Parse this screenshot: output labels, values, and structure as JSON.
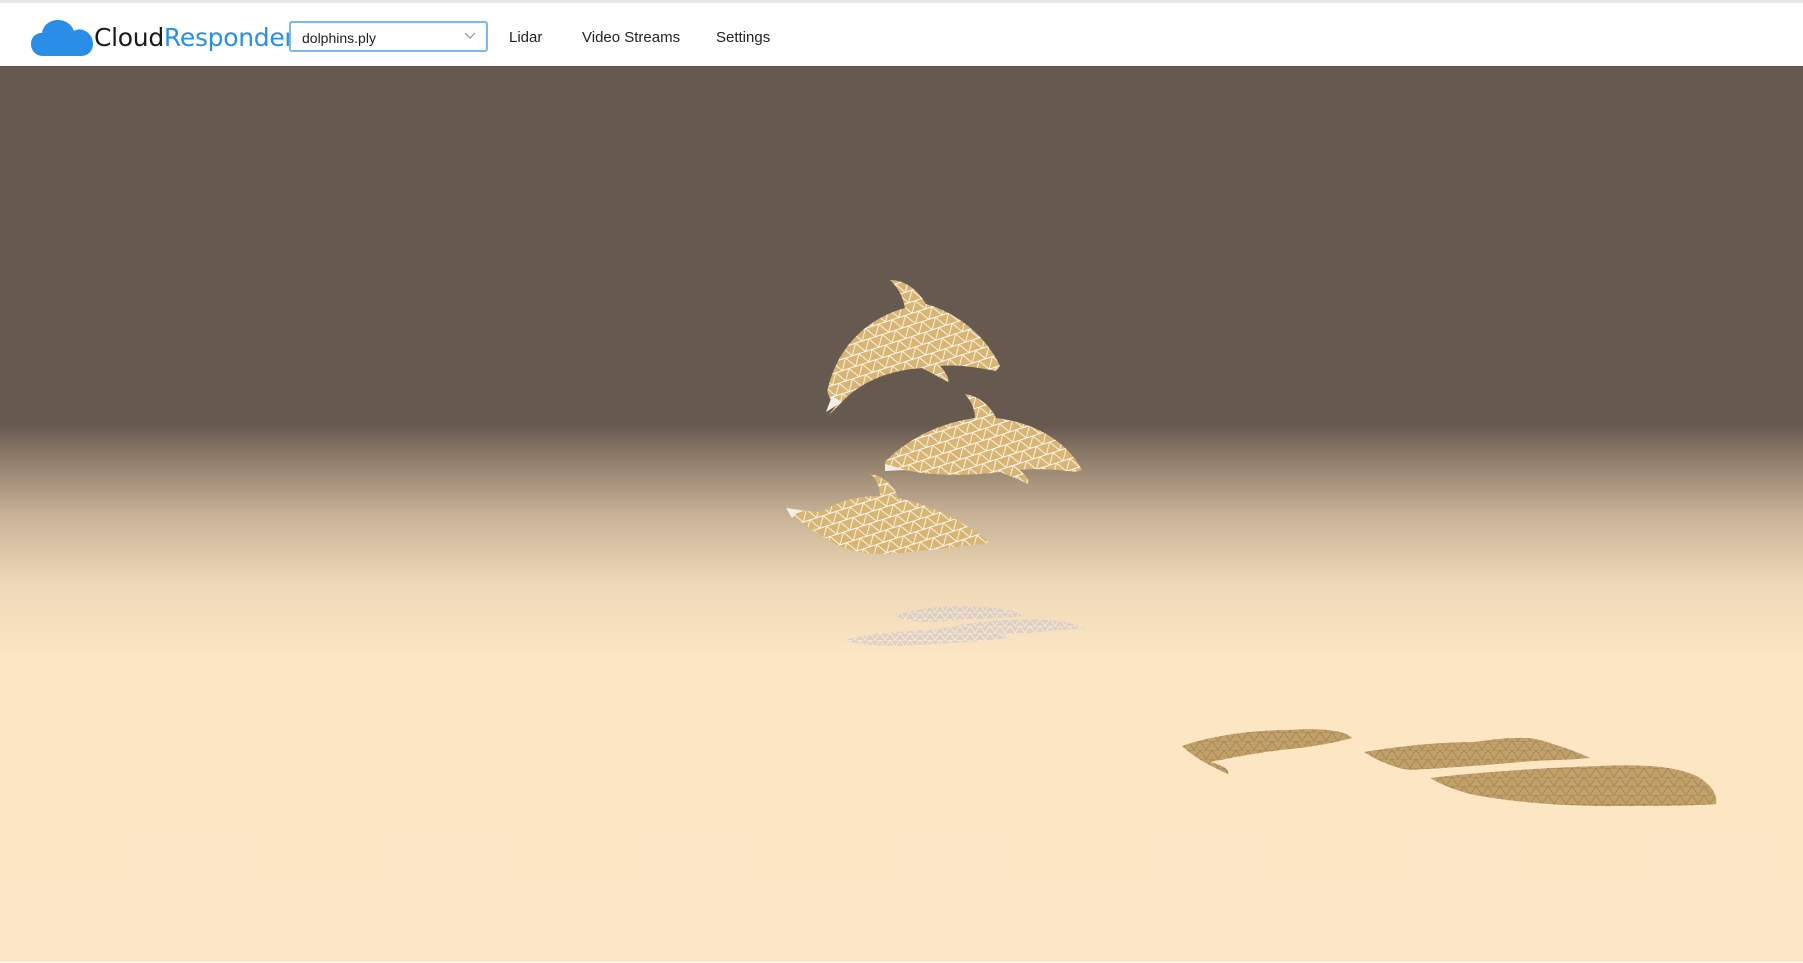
{
  "app": {
    "brand_part1": "Cloud",
    "brand_part2": "Responder",
    "brand_icon": "cloud-icon"
  },
  "file_selector": {
    "value": "dolphins.ply",
    "icon": "chevron-down-icon"
  },
  "nav": {
    "lidar": "Lidar",
    "video_streams": "Video Streams",
    "settings": "Settings"
  },
  "colors": {
    "brand_blue": "#2b8ee6",
    "sky": "#665950",
    "ground": "#fde6c5",
    "mesh_fill": "#d9b574",
    "mesh_wire": "#ffffff",
    "shadow": "#b8965a"
  },
  "scene": {
    "objects": [
      {
        "name": "dolphin-1",
        "kind": "wireframe-mesh"
      },
      {
        "name": "dolphin-2",
        "kind": "wireframe-mesh"
      },
      {
        "name": "dolphin-3",
        "kind": "wireframe-mesh"
      }
    ]
  }
}
